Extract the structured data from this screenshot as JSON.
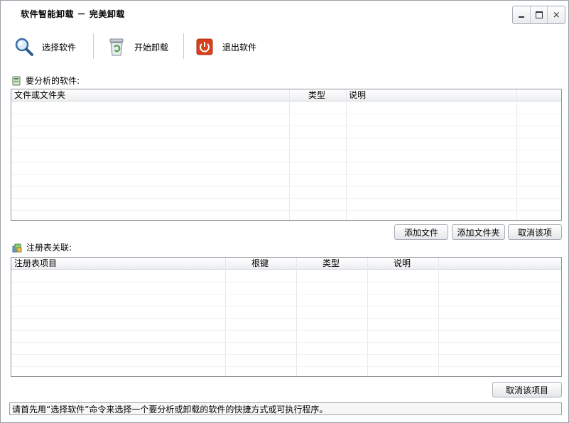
{
  "window": {
    "title": "软件智能卸载 － 完美卸载"
  },
  "window_controls": {
    "minimize": "minimize",
    "maximize": "maximize",
    "close": "×"
  },
  "toolbar": {
    "select_label": "选择软件",
    "uninstall_label": "开始卸载",
    "exit_label": "退出软件",
    "select_icon": "magnifier-icon",
    "uninstall_icon": "recycle-bin-icon",
    "exit_icon": "power-icon"
  },
  "files_section": {
    "label": "要分析的软件:",
    "columns": [
      "文件或文件夹",
      "类型",
      "说明"
    ],
    "rows": []
  },
  "file_buttons": {
    "add_file": "添加文件",
    "add_folder": "添加文件夹",
    "remove_item": "取消该项"
  },
  "registry_section": {
    "label": "注册表关联:",
    "columns": [
      "注册表项目",
      "根键",
      "类型",
      "说明"
    ],
    "rows": []
  },
  "registry_buttons": {
    "remove_item": "取消该项目"
  },
  "status": {
    "text": "请首先用“选择软件”命令来选择一个要分析或卸载的软件的快捷方式或可执行程序。"
  },
  "colors": {
    "exit_icon_red": "#d9401e",
    "grid_border": "#8f959b",
    "window_border": "#9aa0a8"
  }
}
